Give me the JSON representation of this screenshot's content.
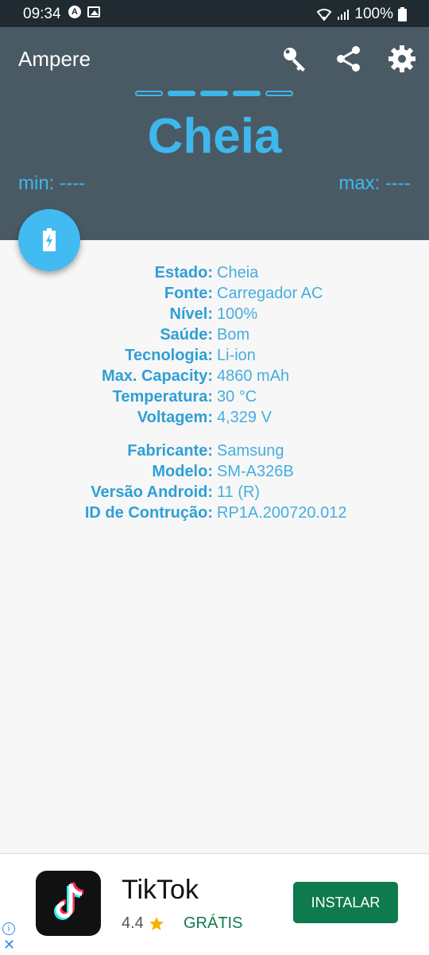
{
  "status_bar": {
    "time": "09:34",
    "notif_letter": "A",
    "battery": "100%"
  },
  "app": {
    "title": "Ampere",
    "icons": [
      "key-icon",
      "share-icon",
      "gear-icon"
    ],
    "accent": "#3eb8ec",
    "header_color": "#4a5a65"
  },
  "charge_indicator": {
    "state": "Cheia",
    "min": "min: ----",
    "max": "max: ----",
    "dash_levels_filled": 3,
    "dash_total": 5
  },
  "info_group1": [
    {
      "label": "Estado:",
      "value": "Cheia"
    },
    {
      "label": "Fonte:",
      "value": "Carregador AC"
    },
    {
      "label": "Nível:",
      "value": "100%"
    },
    {
      "label": "Saúde:",
      "value": "Bom"
    },
    {
      "label": "Tecnologia:",
      "value": "Li-ion"
    },
    {
      "label": "Max. Capacity:",
      "value": "4860 mAh"
    },
    {
      "label": "Temperatura:",
      "value": "30 °C"
    },
    {
      "label": "Voltagem:",
      "value": "4,329 V"
    }
  ],
  "info_group2": [
    {
      "label": "Fabricante:",
      "value": "Samsung"
    },
    {
      "label": "Modelo:",
      "value": "SM-A326B"
    },
    {
      "label": "Versão Android:",
      "value": "11 (R)"
    },
    {
      "label": "ID de Contrução:",
      "value": "RP1A.200720.012"
    }
  ],
  "ad": {
    "app_name": "TikTok",
    "rating": "4.4",
    "price": "GRÁTIS",
    "button": "INSTALAR",
    "button_color": "#0f7a4d"
  }
}
